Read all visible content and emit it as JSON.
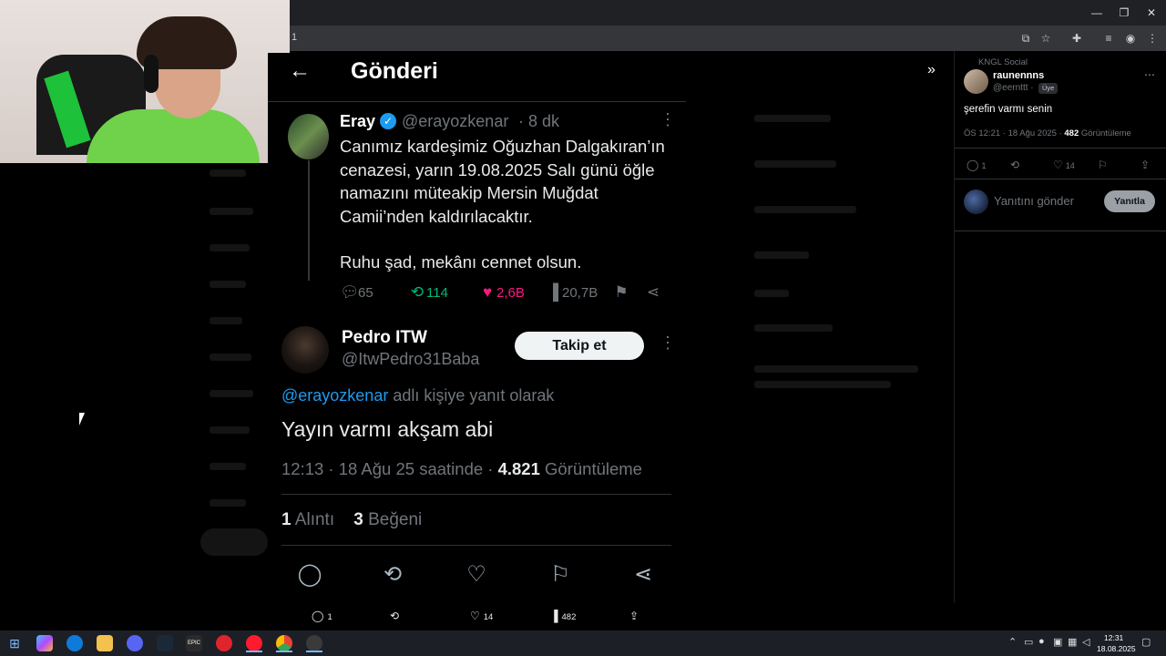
{
  "browser": {
    "url": "1",
    "window_controls": [
      "—",
      "❐",
      "✕"
    ]
  },
  "post_view": {
    "title": "Gönderi",
    "original": {
      "name": "Eray",
      "handle": "@erayozkenar",
      "separator": "·",
      "time": "8 dk",
      "text": "Canımız kardeşimiz Oğuzhan Dalgakıran’ın cenazesi, yarın 19.08.2025 Salı günü öğle namazını müteakip Mersin Muğdat Camii’nden kaldırılacaktır.",
      "text2": "Ruhu şad, mekânı cennet olsun.",
      "replies": "65",
      "reposts": "114",
      "likes": "2,6B",
      "views": "20,7B"
    },
    "reply": {
      "name": "Pedro ITW",
      "handle": "@ItwPedro31Baba",
      "follow_label": "Takip et",
      "replying_mention": "@erayozkenar",
      "replying_suffix": " adlı kişiye yanıt olarak",
      "text": "Yayın varmı akşam abi",
      "meta_prefix": "12:13 · 18 Ağu 25 saatinde · ",
      "views_count": "4.821",
      "views_label": " Görüntüleme",
      "quotes_count": "1",
      "quotes_label": " Alıntı",
      "likes_count": "3",
      "likes_label": " Beğeni"
    }
  },
  "side_post": {
    "community": "KNGL Social",
    "name": "raunennns",
    "handle": "@eernttt ·",
    "badge": "Üye",
    "text": "şerefin varmı senin",
    "meta_prefix": "ÖS 12:21 · 18 Ağu 2025 · ",
    "views_count": "482",
    "views_label": " Görüntüleme",
    "replies": "1",
    "likes": "14",
    "reply_placeholder": "Yanıtını gönder",
    "reply_button": "Yanıtla"
  },
  "page_bar": {
    "replies": "1",
    "likes": "14",
    "views": "482"
  },
  "taskbar": {
    "time": "12:31",
    "date": "18.08.2025"
  },
  "colors": {
    "accent": "#1d9bf0",
    "like": "#f91880",
    "repost": "#00ba7c",
    "background": "#000000"
  }
}
